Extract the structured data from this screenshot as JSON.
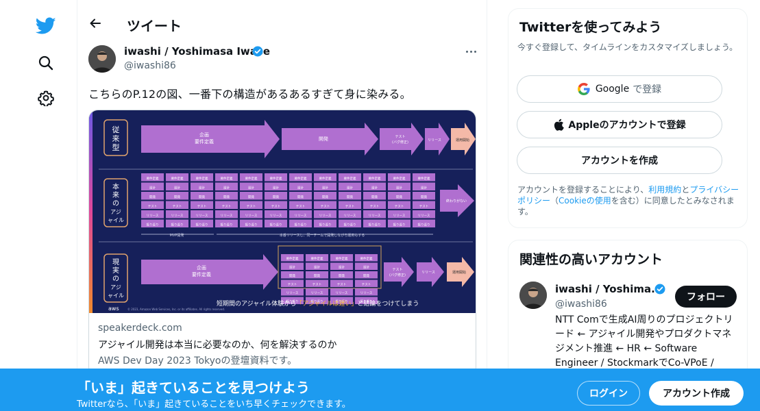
{
  "nav": {
    "logo_icon": "twitter-bird-icon",
    "search_icon": "search-icon",
    "settings_icon": "gear-icon",
    "brand_color": "#1d9bf0"
  },
  "header": {
    "back_icon": "back-arrow-icon",
    "title": "ツイート"
  },
  "tweet": {
    "author_name": "iwashi / Yoshimasa Iwase",
    "author_handle": "@iwashi86",
    "text": "こちらのP.12の図、一番下の構造があるあるすぎて身に染みる。",
    "card": {
      "slide": {
        "row1_label": "従来型",
        "row2_label": "本来のアジャイル",
        "row3_label": "現実のアジャイル",
        "plan_label": "企画 要件定義",
        "dev_label": "開発",
        "test_label": "テスト (バグ修正)",
        "release_label": "リリース",
        "ops_label": "運用開始",
        "cell_labels": [
          "要件定義",
          "設計",
          "開発",
          "テスト",
          "リリース",
          "振り返り"
        ],
        "endless_label": "終わりがない",
        "mvp_label": "MVP開発",
        "note_label": "本番リリースし、同一チームで開発しながら運用もする",
        "bottom_text": "短期間のアジャイル体験から",
        "bottom_highlight": "「アジャイルは遅い」",
        "bottom_text_end": "と結論をつけてしまう",
        "aws_label": "aws",
        "copyright": "© 2023, Amazon Web Services, Inc. or its affiliates. All rights reserved."
      },
      "domain": "speakerdeck.com",
      "title": "アジャイル開発は本当に必要なのか、何を解決するのか",
      "description": "AWS Dev Day 2023 Tokyoの登壇資料です。"
    }
  },
  "signup": {
    "title": "Twitterを使ってみよう",
    "subtitle": "今すぐ登録して、タイムラインをカスタマイズしましょう。",
    "google_label": "Google",
    "google_suffix": "で登録",
    "apple_label": "Appleのアカウントで登録",
    "create_label": "アカウントを作成",
    "legal_prefix": "アカウントを登録することにより、",
    "terms_link": "利用規約",
    "legal_and": "と",
    "privacy_link": "プライバシーポリシー",
    "legal_paren_open": "（",
    "cookie_link": "Cookieの使用",
    "legal_suffix": "を含む）に同意したとみなされます。"
  },
  "related": {
    "title": "関連性の高いアカウント",
    "name": "iwashi / Yoshima...",
    "handle": "@iwashi86",
    "follow_label": "フォロー",
    "bio": "NTT Comで生成AI周りのプロジェクトリード ← アジャイル開発やプロダクトマネジメント推進 ← HR ← Software Engineer / StockmarkでCo-VPoE /"
  },
  "banner": {
    "title": "「いま」起きていることを見つけよう",
    "subtitle": "Twitterなら、「いま」起きていることをいち早くチェックできます。",
    "login_label": "ログイン",
    "create_label": "アカウント作成",
    "color": "#1d9bf0"
  }
}
